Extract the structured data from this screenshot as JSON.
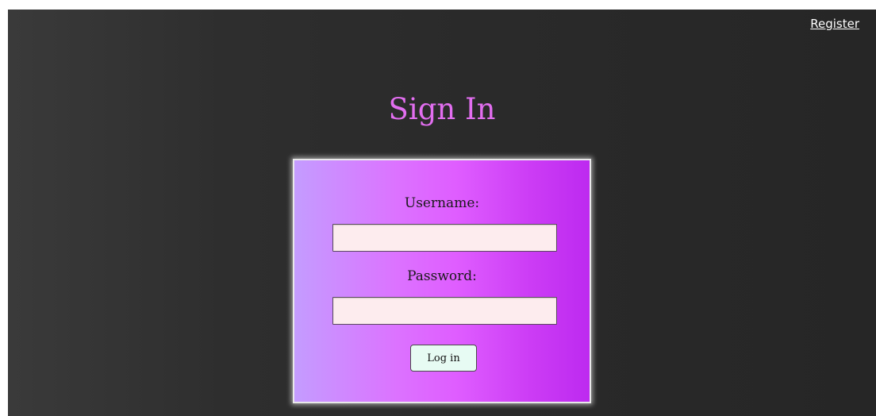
{
  "header": {
    "register_link": "Register"
  },
  "main": {
    "title": "Sign In"
  },
  "login_form": {
    "username_label": "Username:",
    "username_value": "",
    "password_label": "Password:",
    "password_value": "",
    "submit_label": "Log in"
  },
  "colors": {
    "background": "#2a2a2a",
    "title": "#e26ef0",
    "card_gradient_start": "#c49cff",
    "card_gradient_end": "#bd2af0",
    "input_background": "#fdecee",
    "button_background": "#e7fbf3"
  }
}
